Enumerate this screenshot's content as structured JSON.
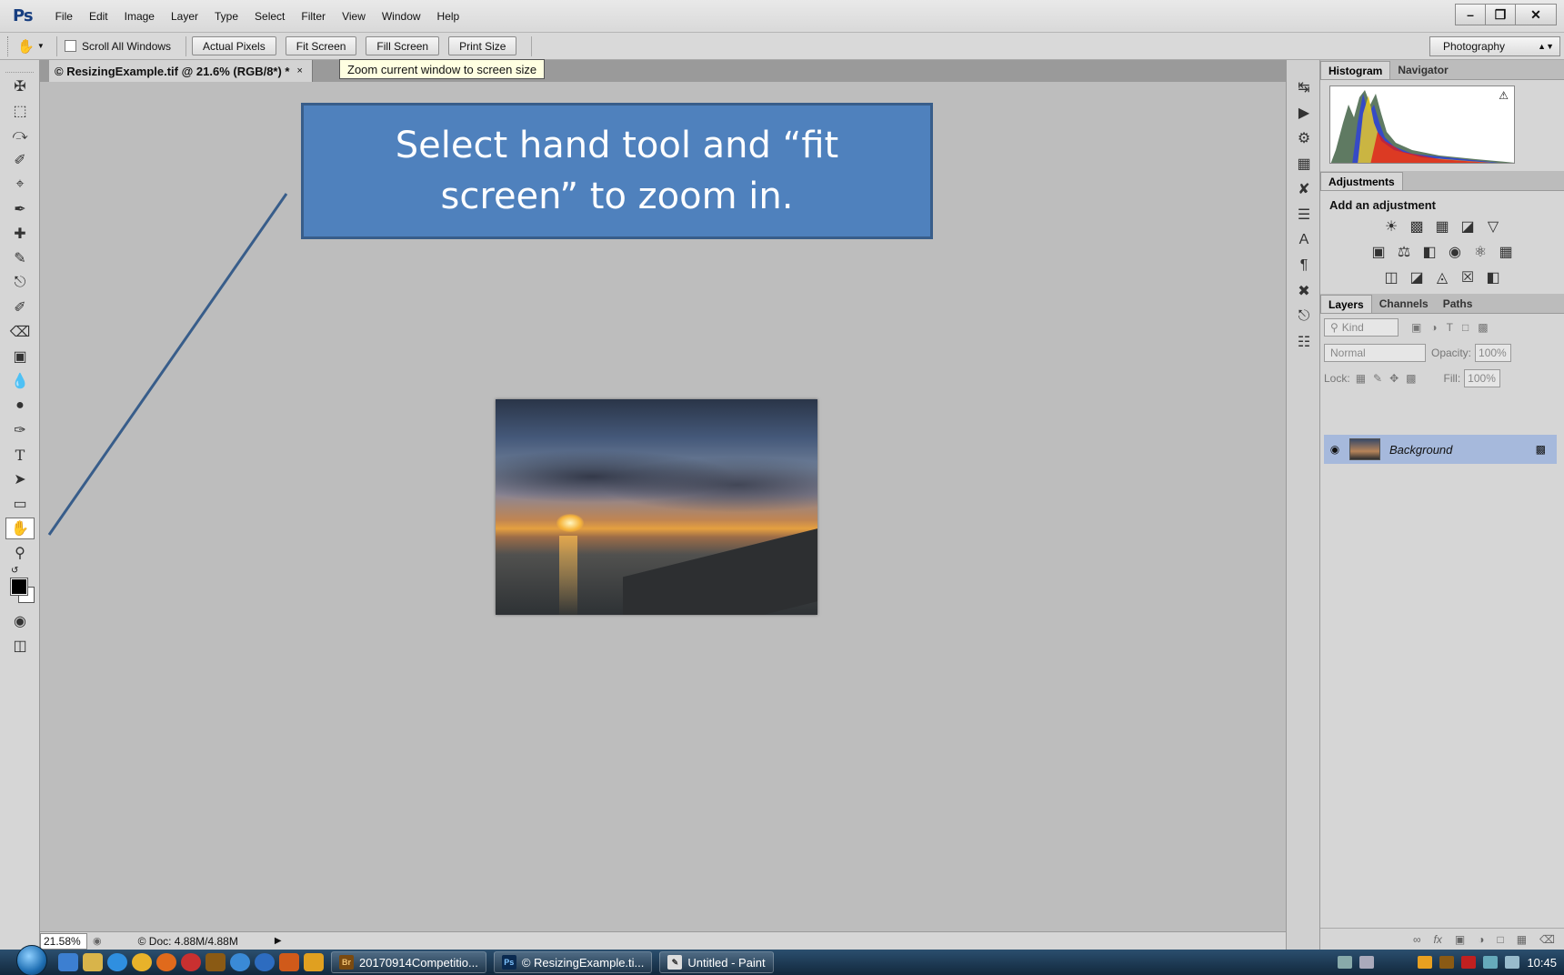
{
  "app": {
    "logo": "Ps",
    "menus": [
      "File",
      "Edit",
      "Image",
      "Layer",
      "Type",
      "Select",
      "Filter",
      "View",
      "Window",
      "Help"
    ]
  },
  "options_bar": {
    "scroll_all_label": "Scroll All Windows",
    "buttons": [
      "Actual Pixels",
      "Fit Screen",
      "Fill Screen",
      "Print Size"
    ],
    "workspace": "Photography"
  },
  "document": {
    "tab_title": "© ResizingExample.tif @ 21.6% (RGB/8*) *",
    "tab_close": "×"
  },
  "tooltip": "Zoom current window to screen size",
  "callout": {
    "text": "Select hand tool and “fit screen” to zoom in."
  },
  "status_bar": {
    "zoom": "21.58%",
    "doc_size": "© Doc: 4.88M/4.88M"
  },
  "panels": {
    "histogram_tabs": [
      "Histogram",
      "Navigator"
    ],
    "adjustments_tab": "Adjustments",
    "adjustments_title": "Add an adjustment",
    "layers_tabs": [
      "Layers",
      "Channels",
      "Paths"
    ],
    "filter_kind": "Kind",
    "blend_mode": "Normal",
    "opacity_label": "Opacity:",
    "opacity_value": "100%",
    "lock_label": "Lock:",
    "fill_label": "Fill:",
    "fill_value": "100%",
    "layer_name": "Background"
  },
  "taskbar": {
    "tasks": [
      "20170914Competitio...",
      "© ResizingExample.ti...",
      "Untitled - Paint"
    ],
    "clock": "10:45"
  },
  "colors": {
    "callout_fill": "#4f81bd",
    "callout_border": "#385d8a",
    "canvas_bg": "#bdbdbd",
    "layer_selected": "#a6b9dc"
  },
  "icons": {
    "tools": [
      "move-icon",
      "marquee-icon",
      "lasso-icon",
      "quick-select-icon",
      "crop-icon",
      "eyedropper-icon",
      "healing-brush-icon",
      "brush-icon",
      "clone-stamp-icon",
      "history-brush-icon",
      "eraser-icon",
      "gradient-icon",
      "blur-icon",
      "dodge-icon",
      "pen-icon",
      "type-icon",
      "path-select-icon",
      "rectangle-icon",
      "hand-icon",
      "zoom-icon"
    ]
  }
}
